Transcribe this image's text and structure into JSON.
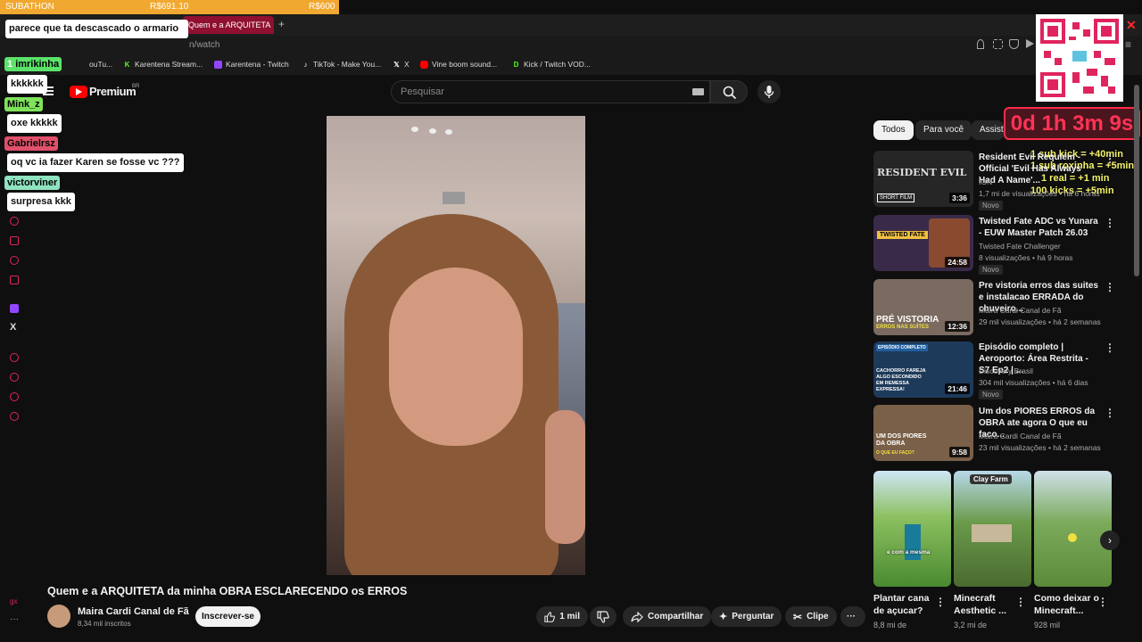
{
  "subathon": {
    "label": "SUBATHON",
    "current": "R$691.10",
    "goal": "R$600"
  },
  "browser": {
    "active_tab": "Quem e a ARQUITETA",
    "url": "n/watch",
    "bookmarks": [
      {
        "label": "ouTu...",
        "icon": "youtube-icon"
      },
      {
        "label": "Karentena Stream...",
        "icon": "kick-icon",
        "color": "#53fc18"
      },
      {
        "label": "Karentena - Twitch",
        "icon": "twitch-icon",
        "color": "#9146ff"
      },
      {
        "label": "TikTok - Make You...",
        "icon": "tiktok-icon"
      },
      {
        "label": "X",
        "icon": "x-icon"
      },
      {
        "label": "Vine boom sound...",
        "icon": "youtube-icon",
        "color": "#ff0000"
      },
      {
        "label": "Kick / Twitch VOD...",
        "icon": "kick-d-icon",
        "color": "#53fc18"
      }
    ]
  },
  "youtube": {
    "logo_text": "Premium",
    "region": "BR",
    "search_placeholder": "Pesquisar"
  },
  "chat": [
    {
      "type": "msg",
      "text": "parece que ta descascado o armario"
    },
    {
      "type": "name",
      "text": "imrikinha",
      "prefix": "1",
      "color": "#5be36a"
    },
    {
      "type": "msg",
      "text": "kkkkkk"
    },
    {
      "type": "name",
      "text": "Mink_z",
      "color": "#7fe35b"
    },
    {
      "type": "msg",
      "text": "oxe kkkkk"
    },
    {
      "type": "name",
      "text": "Gabrielrsz",
      "color": "#e0506a"
    },
    {
      "type": "msg",
      "text": "oq vc ia fazer Karen se fosse vc ???"
    },
    {
      "type": "name",
      "text": "victorviner",
      "color": "#8fe3c0"
    },
    {
      "type": "msg",
      "text": "surpresa kkk"
    }
  ],
  "timer": {
    "display": "0d 1h 3m 9s",
    "rules": [
      "1 sub kick = +40min",
      "1 sub roxinha = +5min",
      "1 real = +1 min",
      "100 kicks = +5min"
    ]
  },
  "chips": [
    "Todos",
    "Para você",
    "Assistidos"
  ],
  "recommendations": [
    {
      "title": "Resident Evil Requiem - Official 'Evil Has Always Had A Name'...",
      "channel": "IGN",
      "verified": true,
      "meta": "1,7 mi de visualizações • há 6 horas",
      "badge": "Novo",
      "duration": "3:36",
      "thumb_color": "#2a2a2a",
      "thumb_text": "RESIDENT EVIL",
      "thumb_sub": "SHORT FILM"
    },
    {
      "title": "Twisted Fate ADC vs Yunara - EUW Master Patch 26.03",
      "channel": "Twisted Fate Challenger",
      "verified": false,
      "meta": "8 visualizações • há 9 horas",
      "badge": "Novo",
      "duration": "24:58",
      "thumb_color": "#3a2a4a",
      "thumb_text": "TWISTED FATE",
      "thumb_sub": ""
    },
    {
      "title": "Pre vistoria erros das suites e instalacao ERRADA do chuveiro...",
      "channel": "Maira Cardi Canal de Fã",
      "verified": false,
      "meta": "29 mil visualizações • há 2 semanas",
      "badge": "",
      "duration": "12:36",
      "thumb_color": "#6a5a50",
      "thumb_text": "PRÉ VISTORIA",
      "thumb_sub": "ERROS NAS SUÍTES"
    },
    {
      "title": "Episódio completo | Aeroporto: Área Restrita - S7 Ep2 | ...",
      "channel": "Discovery Brasil",
      "verified": true,
      "meta": "304 mil visualizações • há 6 dias",
      "badge": "Novo",
      "duration": "21:46",
      "thumb_color": "#1e3a5a",
      "thumb_text": "CACHORRO FAREJA ALGO ESCONDIDO EM REMESSA EXPRESSA!",
      "thumb_sub": "EPISÓDIO COMPLETO"
    },
    {
      "title": "Um dos PIORES ERROS da OBRA ate agora O que eu faco...",
      "channel": "Maira Cardi Canal de Fã",
      "verified": false,
      "meta": "23 mil visualizações • há 2 semanas",
      "badge": "",
      "duration": "9:58",
      "thumb_color": "#7a6048",
      "thumb_text": "UM DOS PIORES DA OBRA",
      "thumb_sub": "O QUE EU FAÇO?"
    }
  ],
  "shorts": [
    {
      "title": "Plantar cana de açucar?",
      "views": "8,8 mi de",
      "overlay": "e com a mesma",
      "color": "#5aa03a"
    },
    {
      "title": "Minecraft Aesthetic ...",
      "views": "3,2 mi de",
      "overlay": "Clay Farm",
      "color": "#4a7a3a"
    },
    {
      "title": "Como deixar o Minecraft...",
      "views": "928 mil",
      "overlay": "",
      "color": "#6a9a4a"
    }
  ],
  "video": {
    "title": "Quem e a ARQUITETA da minha OBRA ESCLARECENDO os ERROS",
    "channel": "Maira Cardi Canal de Fã",
    "subscribers": "8,34 mil inscritos",
    "subscribe_label": "Inscrever-se",
    "likes": "1 mil",
    "share_label": "Compartilhar",
    "ask_label": "Perguntar",
    "clip_label": "Clipe"
  }
}
